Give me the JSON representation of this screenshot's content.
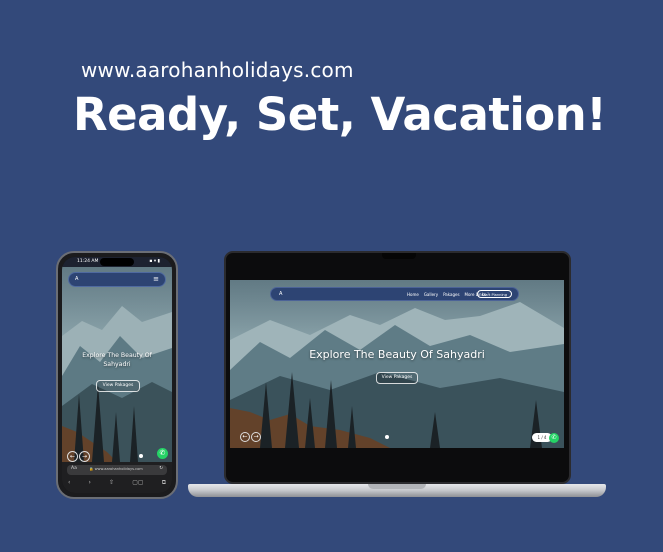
{
  "poster": {
    "url": "www.aarohanholidays.com",
    "headline": "Ready, Set, Vacation!"
  },
  "laptop_site": {
    "logo": "A",
    "nav_links": [
      "Home",
      "Gallery",
      "Pakages",
      "More Links ˅"
    ],
    "cta": "Start Planning",
    "hero_title": "Explore The Beauty Of Sahyadri",
    "hero_button": "View Pakages",
    "pager": "1 / 4"
  },
  "phone_site": {
    "time": "11:24 AM",
    "status_icons": "▪ ▾ ▮",
    "logo": "A",
    "menu_icon": "≡",
    "hero_title": "Explore The Beauty Of Sahyadri",
    "hero_button": "View Pakages",
    "address_aa": "Aa",
    "address": "🔒 www.aarohanholidays.com",
    "reload": "↻",
    "toolbar": [
      "‹",
      "›",
      "⇧",
      "▢▢",
      "⧉"
    ]
  },
  "colors": {
    "background": "#33497a",
    "nav": "#2d4473",
    "whatsapp": "#25d366"
  }
}
